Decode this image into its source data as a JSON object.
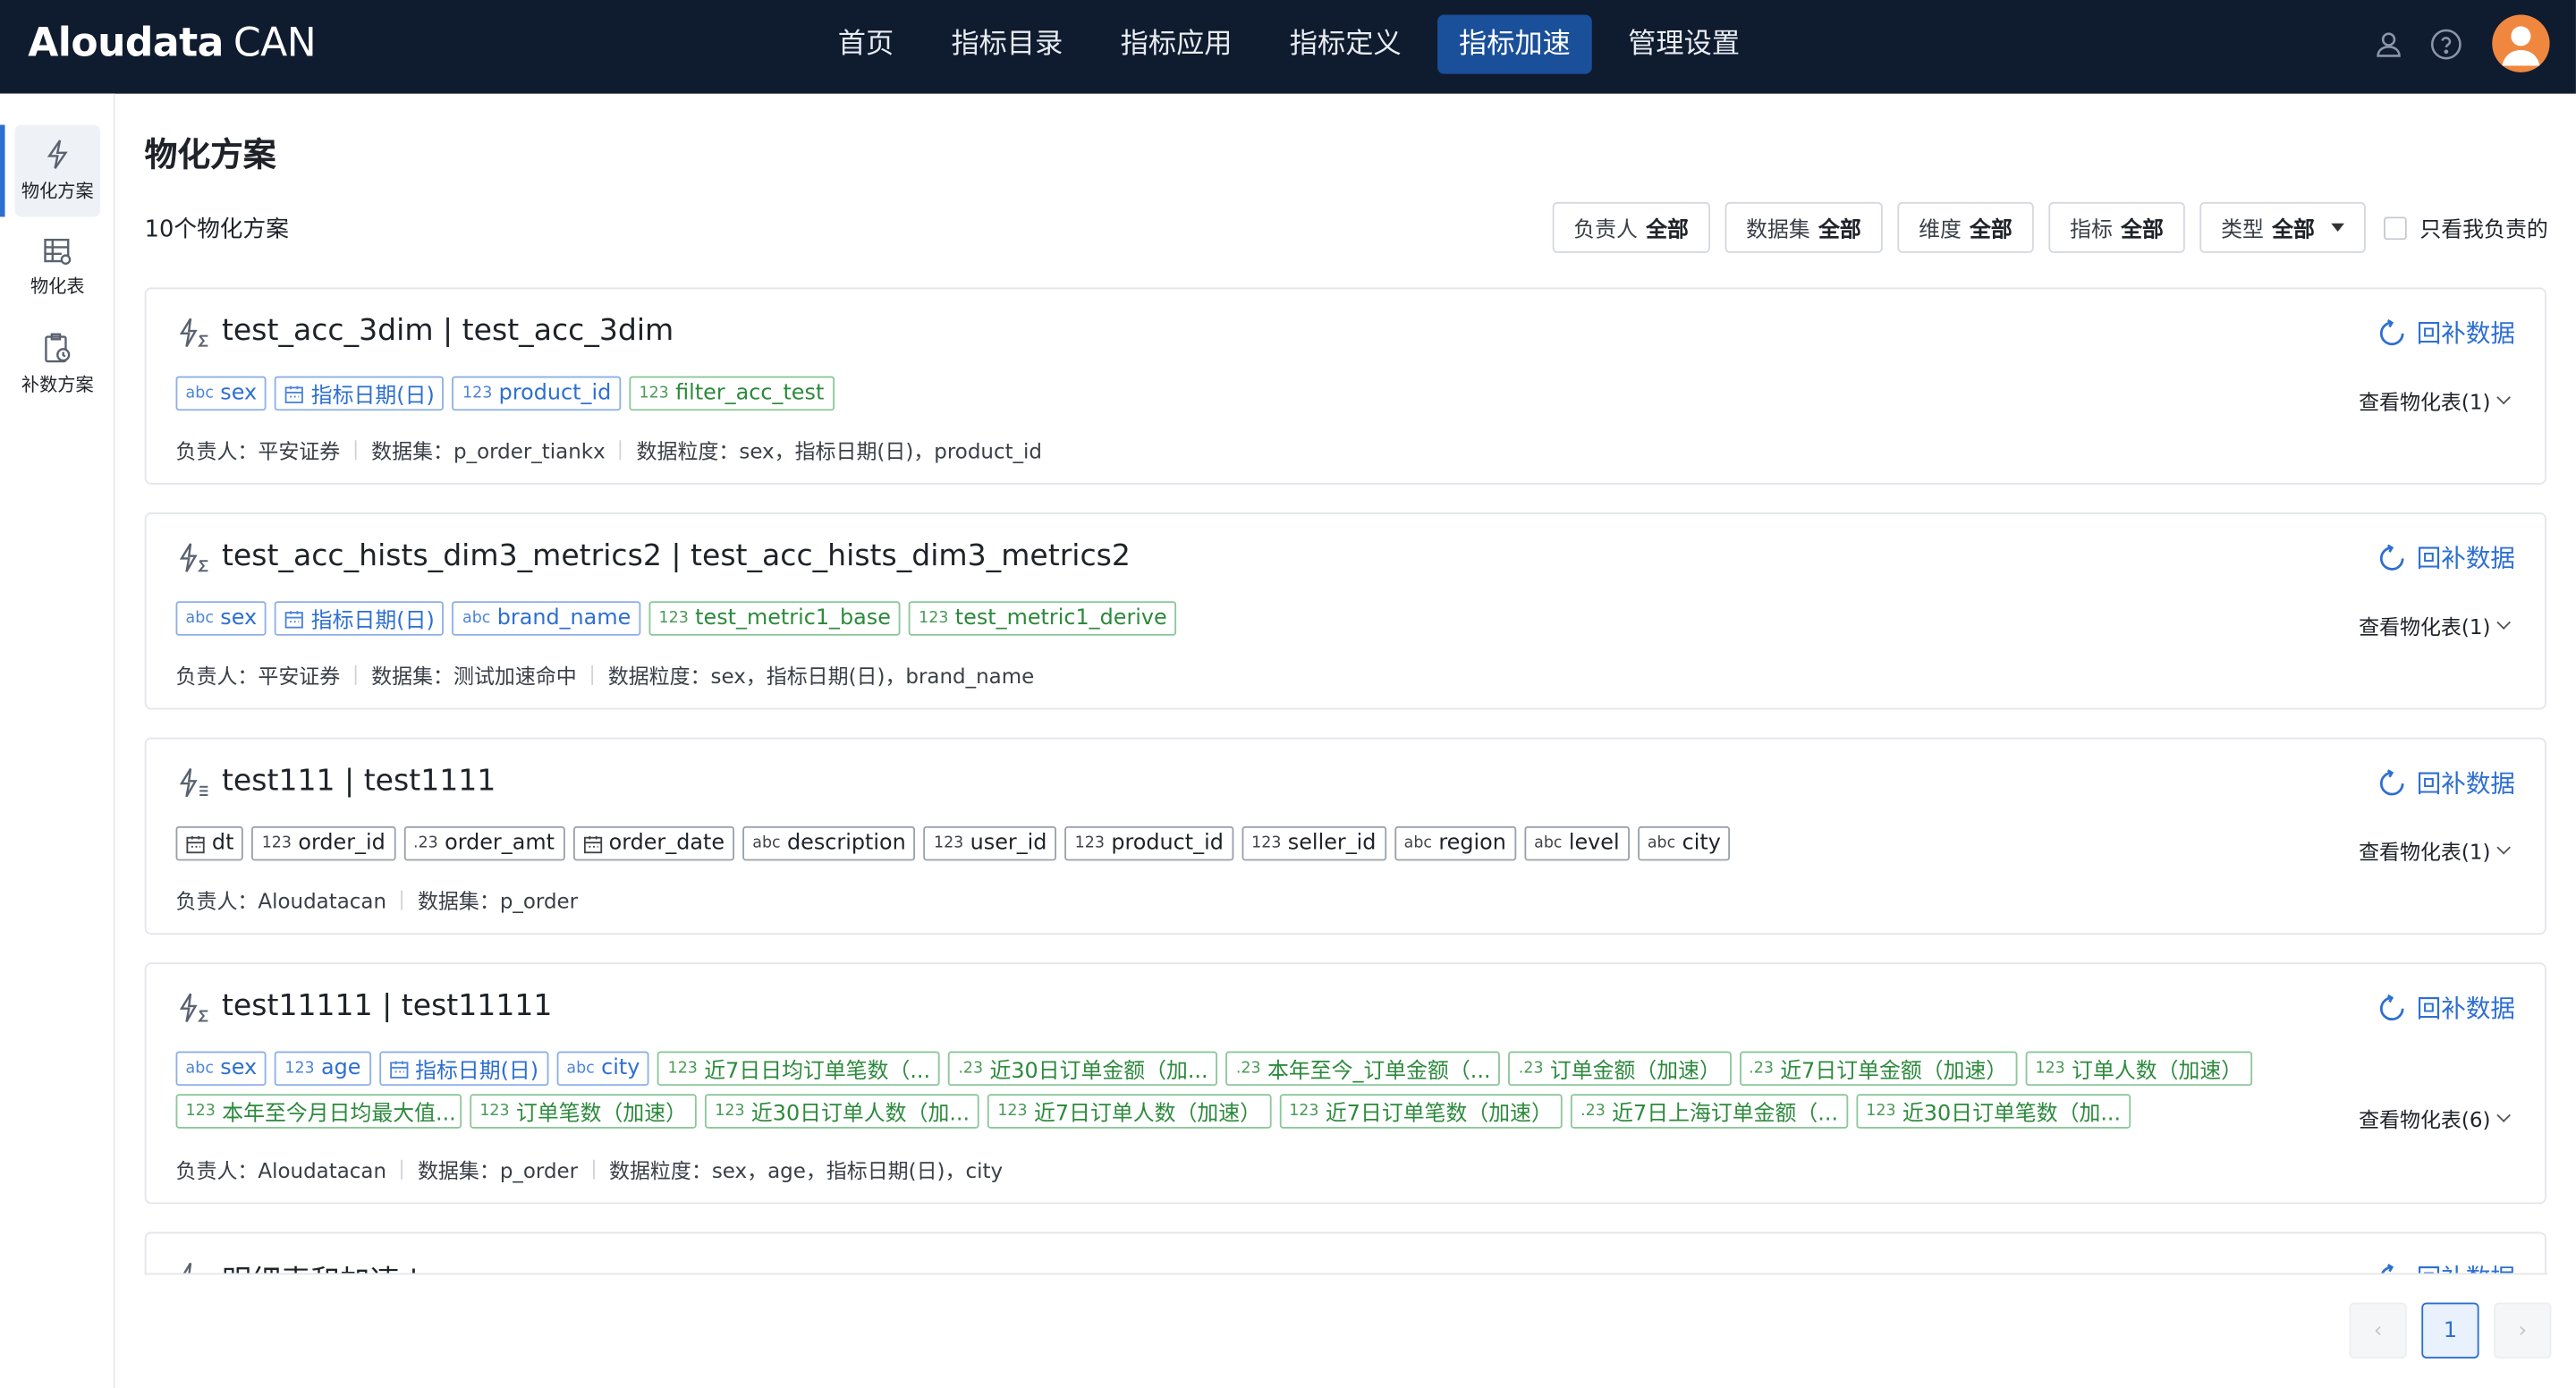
{
  "app": {
    "logo_main": "Aloudata",
    "logo_sub": "CAN"
  },
  "nav": [
    {
      "label": "首页",
      "active": false
    },
    {
      "label": "指标目录",
      "active": false
    },
    {
      "label": "指标应用",
      "active": false
    },
    {
      "label": "指标定义",
      "active": false
    },
    {
      "label": "指标加速",
      "active": true
    },
    {
      "label": "管理设置",
      "active": false
    }
  ],
  "sidebar": [
    {
      "label": "物化方案",
      "icon": "lightning-icon",
      "active": true
    },
    {
      "label": "物化表",
      "icon": "table-icon",
      "active": false
    },
    {
      "label": "补数方案",
      "icon": "clipboard-icon",
      "active": false
    }
  ],
  "page": {
    "title": "物化方案",
    "count_label": "10个物化方案"
  },
  "filters": [
    {
      "label": "负责人",
      "value": "全部",
      "caret": false
    },
    {
      "label": "数据集",
      "value": "全部",
      "caret": false
    },
    {
      "label": "维度",
      "value": "全部",
      "caret": false
    },
    {
      "label": "指标",
      "value": "全部",
      "caret": false
    },
    {
      "label": "类型",
      "value": "全部",
      "caret": true
    }
  ],
  "only_mine_label": "只看我负责的",
  "refill_label": "回补数据",
  "cards": [
    {
      "title": "test_acc_3dim | test_acc_3dim",
      "icon": "lightning-sigma-icon",
      "tags": [
        {
          "type": "abc",
          "text": "sex",
          "color": "blue"
        },
        {
          "type": "date",
          "text": "指标日期(日)",
          "color": "blue"
        },
        {
          "type": "123",
          "text": "product_id",
          "color": "blue"
        },
        {
          "type": "123",
          "text": "filter_acc_test",
          "color": "green"
        }
      ],
      "view_table": "查看物化表(1)",
      "meta": [
        {
          "k": "负责人：",
          "v": "平安证券"
        },
        {
          "k": "数据集：",
          "v": "p_order_tiankx"
        },
        {
          "k": "数据粒度：",
          "v": "sex，指标日期(日)，product_id"
        }
      ]
    },
    {
      "title": "test_acc_hists_dim3_metrics2 | test_acc_hists_dim3_metrics2",
      "icon": "lightning-sigma-icon",
      "tags": [
        {
          "type": "abc",
          "text": "sex",
          "color": "blue"
        },
        {
          "type": "date",
          "text": "指标日期(日)",
          "color": "blue"
        },
        {
          "type": "abc",
          "text": "brand_name",
          "color": "blue"
        },
        {
          "type": "123",
          "text": "test_metric1_base",
          "color": "green"
        },
        {
          "type": "123",
          "text": "test_metric1_derive",
          "color": "green"
        }
      ],
      "view_table": "查看物化表(1)",
      "meta": [
        {
          "k": "负责人：",
          "v": "平安证券"
        },
        {
          "k": "数据集：",
          "v": "测试加速命中"
        },
        {
          "k": "数据粒度：",
          "v": "sex，指标日期(日)，brand_name"
        }
      ]
    },
    {
      "title": "test111 | test1111",
      "icon": "lightning-list-icon",
      "tags": [
        {
          "type": "date",
          "text": "dt",
          "color": "gray"
        },
        {
          "type": "123",
          "text": "order_id",
          "color": "gray"
        },
        {
          "type": ".23",
          "text": "order_amt",
          "color": "gray"
        },
        {
          "type": "date",
          "text": "order_date",
          "color": "gray"
        },
        {
          "type": "abc",
          "text": "description",
          "color": "gray"
        },
        {
          "type": "123",
          "text": "user_id",
          "color": "gray"
        },
        {
          "type": "123",
          "text": "product_id",
          "color": "gray"
        },
        {
          "type": "123",
          "text": "seller_id",
          "color": "gray"
        },
        {
          "type": "abc",
          "text": "region",
          "color": "gray"
        },
        {
          "type": "abc",
          "text": "level",
          "color": "gray"
        },
        {
          "type": "abc",
          "text": "city",
          "color": "gray"
        }
      ],
      "view_table": "查看物化表(1)",
      "meta": [
        {
          "k": "负责人：",
          "v": "Aloudatacan"
        },
        {
          "k": "数据集：",
          "v": "p_order"
        }
      ]
    },
    {
      "title": "test11111 | test11111",
      "icon": "lightning-sigma-icon",
      "tags": [
        {
          "type": "abc",
          "text": "sex",
          "color": "blue"
        },
        {
          "type": "123",
          "text": "age",
          "color": "blue"
        },
        {
          "type": "date",
          "text": "指标日期(日)",
          "color": "blue"
        },
        {
          "type": "abc",
          "text": "city",
          "color": "blue"
        },
        {
          "type": "123",
          "text": "近7日日均订单笔数（...",
          "color": "green",
          "trunc": true
        },
        {
          "type": ".23",
          "text": "近30日订单金额（加...",
          "color": "green",
          "trunc": true
        },
        {
          "type": ".23",
          "text": "本年至今_订单金额（...",
          "color": "green",
          "trunc": true
        },
        {
          "type": ".23",
          "text": "订单金额（加速）",
          "color": "green"
        },
        {
          "type": ".23",
          "text": "近7日订单金额（加速）",
          "color": "green"
        },
        {
          "type": "123",
          "text": "订单人数（加速）",
          "color": "green"
        },
        {
          "type": "123",
          "text": "本年至今月日均最大值...",
          "color": "green",
          "trunc": true
        },
        {
          "type": "123",
          "text": "订单笔数（加速）",
          "color": "green"
        },
        {
          "type": "123",
          "text": "近30日订单人数（加...",
          "color": "green",
          "trunc": true
        },
        {
          "type": "123",
          "text": "近7日订单人数（加速）",
          "color": "green"
        },
        {
          "type": "123",
          "text": "近7日订单笔数（加速）",
          "color": "green"
        },
        {
          "type": ".23",
          "text": "近7日上海订单金额（...",
          "color": "green",
          "trunc": true
        },
        {
          "type": "123",
          "text": "近30日订单笔数（加...",
          "color": "green",
          "trunc": true
        }
      ],
      "view_table": "查看物化表(6)",
      "meta": [
        {
          "k": "负责人：",
          "v": "Aloudatacan"
        },
        {
          "k": "数据集：",
          "v": "p_order"
        },
        {
          "k": "数据粒度：",
          "v": "sex，age，指标日期(日)，city"
        }
      ]
    },
    {
      "title": "明细表和加速 | ",
      "icon": "lightning-sigma-icon",
      "tags": [],
      "view_table": "",
      "meta": []
    }
  ],
  "pagination": {
    "current": "1",
    "prev": "‹",
    "next": "›"
  }
}
